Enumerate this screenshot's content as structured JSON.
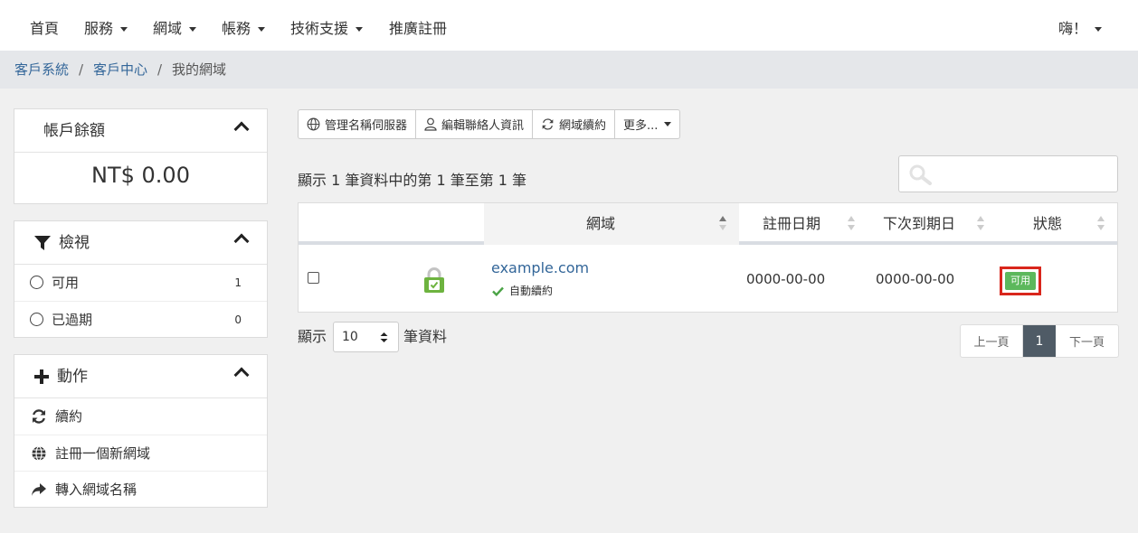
{
  "nav": {
    "items": [
      {
        "label": "首頁",
        "dropdown": false
      },
      {
        "label": "服務",
        "dropdown": true
      },
      {
        "label": "網域",
        "dropdown": true
      },
      {
        "label": "帳務",
        "dropdown": true
      },
      {
        "label": "技術支援",
        "dropdown": true
      },
      {
        "label": "推廣註冊",
        "dropdown": false
      }
    ],
    "user_greeting": "嗨！"
  },
  "breadcrumb": {
    "items": [
      "客戶系統",
      "客戶中心",
      "我的網域"
    ],
    "separator": "/"
  },
  "sidebar": {
    "balance": {
      "title": "帳戶餘額",
      "amount": "NT$ 0.00"
    },
    "view": {
      "title": "檢視",
      "icon": "filter-icon",
      "items": [
        {
          "label": "可用",
          "count": "1"
        },
        {
          "label": "已過期",
          "count": "0"
        }
      ]
    },
    "actions": {
      "title": "動作",
      "icon": "plus-icon",
      "items": [
        {
          "label": "續約",
          "icon": "refresh-icon"
        },
        {
          "label": "註冊一個新網域",
          "icon": "globe-icon"
        },
        {
          "label": "轉入網域名稱",
          "icon": "share-arrow-icon"
        }
      ]
    }
  },
  "toolbar": {
    "nameservers": "管理名稱伺服器",
    "contacts": "編輯聯絡人資訊",
    "renew": "網域續約",
    "more": "更多..."
  },
  "table": {
    "info": "顯示 1 筆資料中的第 1 筆至第 1 筆",
    "search_placeholder": "",
    "headers": {
      "domain": "網域",
      "reg_date": "註冊日期",
      "next_due": "下次到期日",
      "status": "狀態"
    },
    "rows": [
      {
        "domain": "example.com",
        "auto_renew": "自動續約",
        "reg_date": "0000-00-00",
        "next_due": "0000-00-00",
        "status": "可用",
        "icon": "ssl-lock-icon"
      }
    ]
  },
  "length": {
    "prefix": "顯示",
    "value": "10",
    "suffix": "筆資料"
  },
  "pagination": {
    "prev": "上一頁",
    "current": "1",
    "next": "下一頁"
  },
  "colors": {
    "status_active": "#5cb85c",
    "highlight": "#d9261c",
    "link": "#336699",
    "pager_active": "#4f5b66"
  }
}
